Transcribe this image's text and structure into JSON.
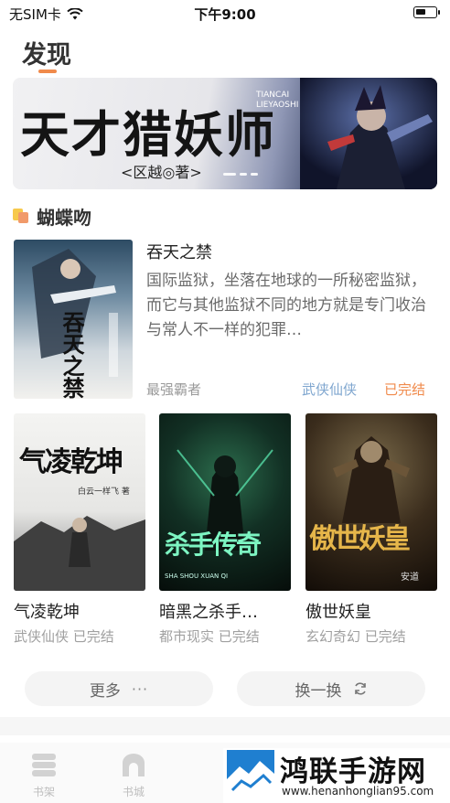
{
  "status_bar": {
    "carrier": "无SIM卡",
    "time": "下午9:00",
    "battery_level": 0.55
  },
  "header": {
    "title": "发现"
  },
  "banner": {
    "title": "天才猎妖师",
    "author_line": "<区越◎著>",
    "latin_lines": [
      "TIANCAI",
      "LIEYAOSHI"
    ]
  },
  "section": {
    "title": "蝴蝶吻"
  },
  "featured": {
    "title": "吞天之禁",
    "description": "国际监狱，坐落在地球的一所秘密监狱，而它与其他监狱不同的地方就是专门收治与常人不一样的犯罪…",
    "author": "最强霸者",
    "genre": "武侠仙侠",
    "status": "已完结",
    "cover_text": "吞天之禁"
  },
  "grid_books": [
    {
      "title": "气凌乾坤",
      "meta": "武侠仙侠 已完结",
      "cover_text": "气凌乾坤",
      "cover_author": "白云一样飞 著"
    },
    {
      "title": "暗黑之杀手…",
      "meta": "都市现实 已完结",
      "cover_text": "杀手传奇",
      "cover_latin": "SHA SHOU XUAN QI"
    },
    {
      "title": "傲世妖皇",
      "meta": "玄幻奇幻 已完结",
      "cover_text": "傲世妖皇",
      "cover_author": "安道"
    }
  ],
  "actions": {
    "more_label": "更多",
    "more_icon": "ellipsis-icon",
    "refresh_label": "换一换",
    "refresh_icon": "refresh-icon"
  },
  "tab_bar": {
    "items": [
      {
        "label": "书架",
        "icon": "bookshelf-icon"
      },
      {
        "label": "书城",
        "icon": "bookstore-icon"
      }
    ]
  },
  "watermark": {
    "text": "鸿联手游网",
    "url": "www.henanhonglian95.com"
  },
  "colors": {
    "accent": "#f08a4b",
    "genre_blue": "#7fa6cf",
    "muted": "#9a9a9a"
  }
}
